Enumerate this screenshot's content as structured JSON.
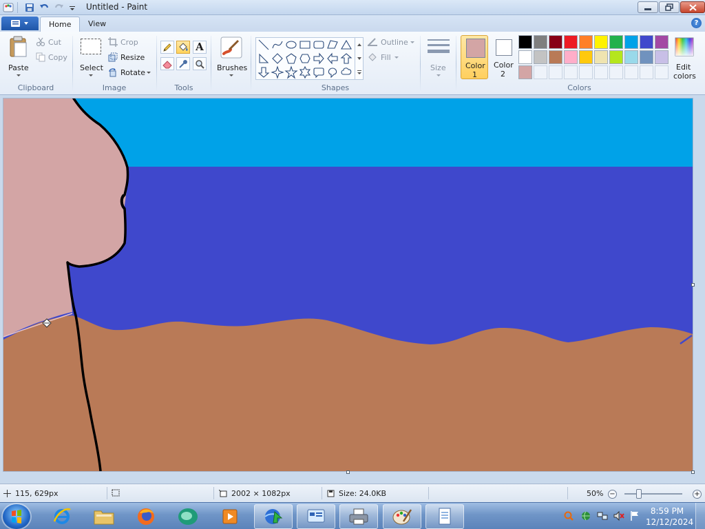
{
  "window": {
    "title": "Untitled - Paint"
  },
  "tabs": [
    {
      "label": "Home"
    },
    {
      "label": "View"
    }
  ],
  "clipboard": {
    "paste_label": "Paste",
    "cut_label": "Cut",
    "copy_label": "Copy",
    "group_label": "Clipboard"
  },
  "image": {
    "select_label": "Select",
    "crop_label": "Crop",
    "resize_label": "Resize",
    "rotate_label": "Rotate",
    "group_label": "Image"
  },
  "tools": {
    "group_label": "Tools",
    "active_tool": "fill-bucket"
  },
  "brushes": {
    "label": "Brushes"
  },
  "shapes": {
    "outline_label": "Outline",
    "fill_label": "Fill",
    "group_label": "Shapes"
  },
  "size": {
    "label": "Size"
  },
  "colors": {
    "color1_label": "Color",
    "color1_num": "1",
    "color2_label": "Color",
    "color2_num": "2",
    "color1_value": "#d3a5a5",
    "color2_value": "#ffffff",
    "edit_label": "Edit",
    "edit_label2": "colors",
    "group_label": "Colors",
    "palette": [
      "#000000",
      "#7f7f7f",
      "#880015",
      "#ed1c24",
      "#ff7f27",
      "#fff200",
      "#22b14c",
      "#00a2e8",
      "#3f48cc",
      "#a349a4",
      "#ffffff",
      "#c3c3c3",
      "#b97a57",
      "#ffaec9",
      "#ffc90e",
      "#efe4b0",
      "#b5e61d",
      "#99d9ea",
      "#7092be",
      "#c8bfe7",
      "#d3a5a5",
      "",
      "",
      "",
      "",
      "",
      "",
      "",
      "",
      ""
    ]
  },
  "canvas_scene": {
    "sky_color": "#00a2e8",
    "sea_color": "#3f48cc",
    "sand_color": "#b97a57",
    "skin_color": "#d3a5a5",
    "outline_color": "#000000"
  },
  "status": {
    "cursor_pos": "115, 629px",
    "dimensions": "2002 × 1082px",
    "size": "Size: 24.0KB",
    "zoom": "50%"
  },
  "taskbar": {
    "time": "8:59 PM",
    "date": "12/12/2024"
  }
}
